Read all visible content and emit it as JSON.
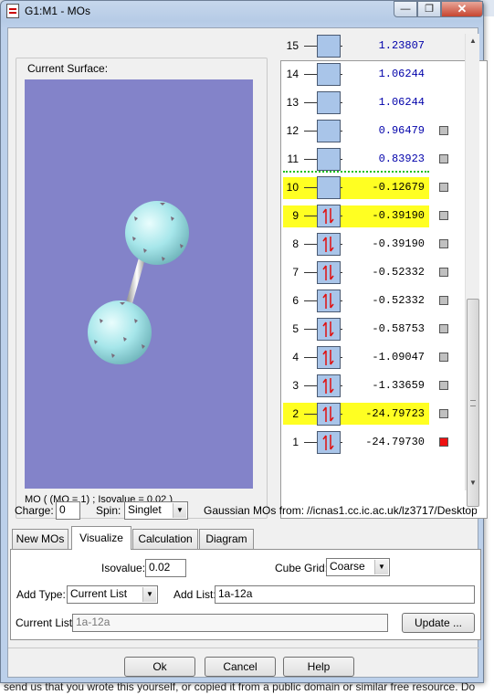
{
  "window": {
    "title": "G1:M1 - MOs",
    "minimize": "—",
    "maximize": "❐",
    "close": "✕"
  },
  "surface": {
    "group_label": "Current Surface:",
    "caption": "MO ( (MO = 1) ; Isovalue = 0.02 )"
  },
  "orbitals": [
    {
      "n": "15",
      "energy": "1.23807",
      "occupied": false,
      "marker": "none",
      "highlight": false
    },
    {
      "n": "14",
      "energy": "1.06244",
      "occupied": false,
      "marker": "none",
      "highlight": false
    },
    {
      "n": "13",
      "energy": "1.06244",
      "occupied": false,
      "marker": "none",
      "highlight": false
    },
    {
      "n": "12",
      "energy": "0.96479",
      "occupied": false,
      "marker": "gray",
      "highlight": false
    },
    {
      "n": "11",
      "energy": "0.83923",
      "occupied": false,
      "marker": "gray",
      "highlight": false
    },
    {
      "n": "10",
      "energy": "-0.12679",
      "occupied": false,
      "marker": "gray",
      "highlight": true
    },
    {
      "n": "9",
      "energy": "-0.39190",
      "occupied": true,
      "marker": "gray",
      "highlight": true
    },
    {
      "n": "8",
      "energy": "-0.39190",
      "occupied": true,
      "marker": "gray",
      "highlight": false
    },
    {
      "n": "7",
      "energy": "-0.52332",
      "occupied": true,
      "marker": "gray",
      "highlight": false
    },
    {
      "n": "6",
      "energy": "-0.52332",
      "occupied": true,
      "marker": "gray",
      "highlight": false
    },
    {
      "n": "5",
      "energy": "-0.58753",
      "occupied": true,
      "marker": "gray",
      "highlight": false
    },
    {
      "n": "4",
      "energy": "-1.09047",
      "occupied": true,
      "marker": "gray",
      "highlight": false
    },
    {
      "n": "3",
      "energy": "-1.33659",
      "occupied": true,
      "marker": "gray",
      "highlight": false
    },
    {
      "n": "2",
      "energy": "-24.79723",
      "occupied": true,
      "marker": "gray",
      "highlight": true
    },
    {
      "n": "1",
      "energy": "-24.79730",
      "occupied": true,
      "marker": "red",
      "highlight": false
    }
  ],
  "charge": {
    "label": "Charge:",
    "value": "0"
  },
  "spin": {
    "label": "Spin:",
    "value": "Singlet"
  },
  "source": {
    "label": "Gaussian MOs from:",
    "path": "//icnas1.cc.ic.ac.uk/lz3717/Desktop"
  },
  "tabs": [
    "New MOs",
    "Visualize",
    "Calculation",
    "Diagram"
  ],
  "active_tab": "Visualize",
  "visualize": {
    "isovalue_label": "Isovalue:",
    "isovalue": "0.02",
    "cube_label": "Cube Grid:",
    "cube": "Coarse",
    "add_type_label": "Add Type:",
    "add_type": "Current List",
    "add_list_label": "Add List:",
    "add_list": "1a-12a",
    "current_list_label": "Current List:",
    "current_list": "1a-12a",
    "update": "Update ..."
  },
  "buttons": {
    "ok": "Ok",
    "cancel": "Cancel",
    "help": "Help"
  },
  "background_text": "send us that you wrote this yourself, or copied it from a public domain or similar free resource. Do",
  "colors": {
    "viewport": "#8383c9",
    "atom": "#a6e6ea",
    "highlight": "#ffff22",
    "homo_line": "#1dbf1d",
    "electron_arrow": "#e01010"
  }
}
